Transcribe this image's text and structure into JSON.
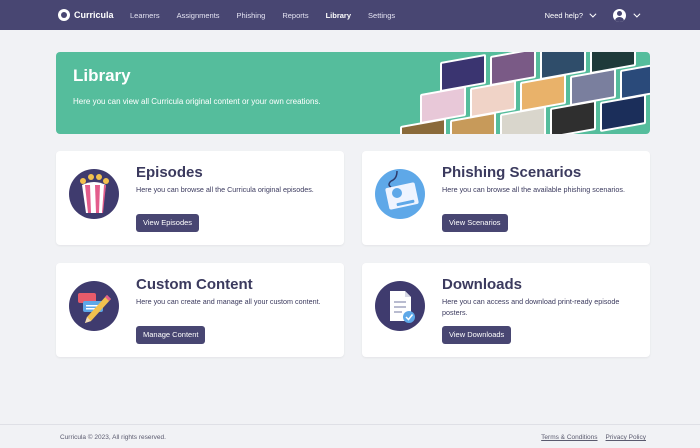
{
  "nav": {
    "brand": "Curricula",
    "links": [
      "Learners",
      "Assignments",
      "Phishing",
      "Reports",
      "Library",
      "Settings"
    ],
    "active": "Library",
    "help": "Need help?"
  },
  "banner": {
    "title": "Library",
    "text": "Here you can view all Curricula original content or your own creations."
  },
  "cards": [
    {
      "title": "Episodes",
      "text": "Here you can browse all the Curricula original episodes.",
      "button": "View Episodes",
      "icon": "popcorn-icon"
    },
    {
      "title": "Phishing Scenarios",
      "text": "Here you can browse all the available phishing scenarios.",
      "button": "View Scenarios",
      "icon": "phishing-hook-icon"
    },
    {
      "title": "Custom Content",
      "text": "Here you can create and manage all your custom content.",
      "button": "Manage Content",
      "icon": "pencil-chat-icon"
    },
    {
      "title": "Downloads",
      "text": "Here you can access and download print-ready episode posters.",
      "button": "View Downloads",
      "icon": "document-check-icon"
    }
  ],
  "footer": {
    "copyright": "Curricula © 2023, All rights reserved.",
    "terms": "Terms & Conditions",
    "privacy": "Privacy Policy"
  },
  "colors": {
    "nav": "#484672",
    "banner": "#55bd9c",
    "button": "#484672",
    "background": "#f1f2f5"
  }
}
